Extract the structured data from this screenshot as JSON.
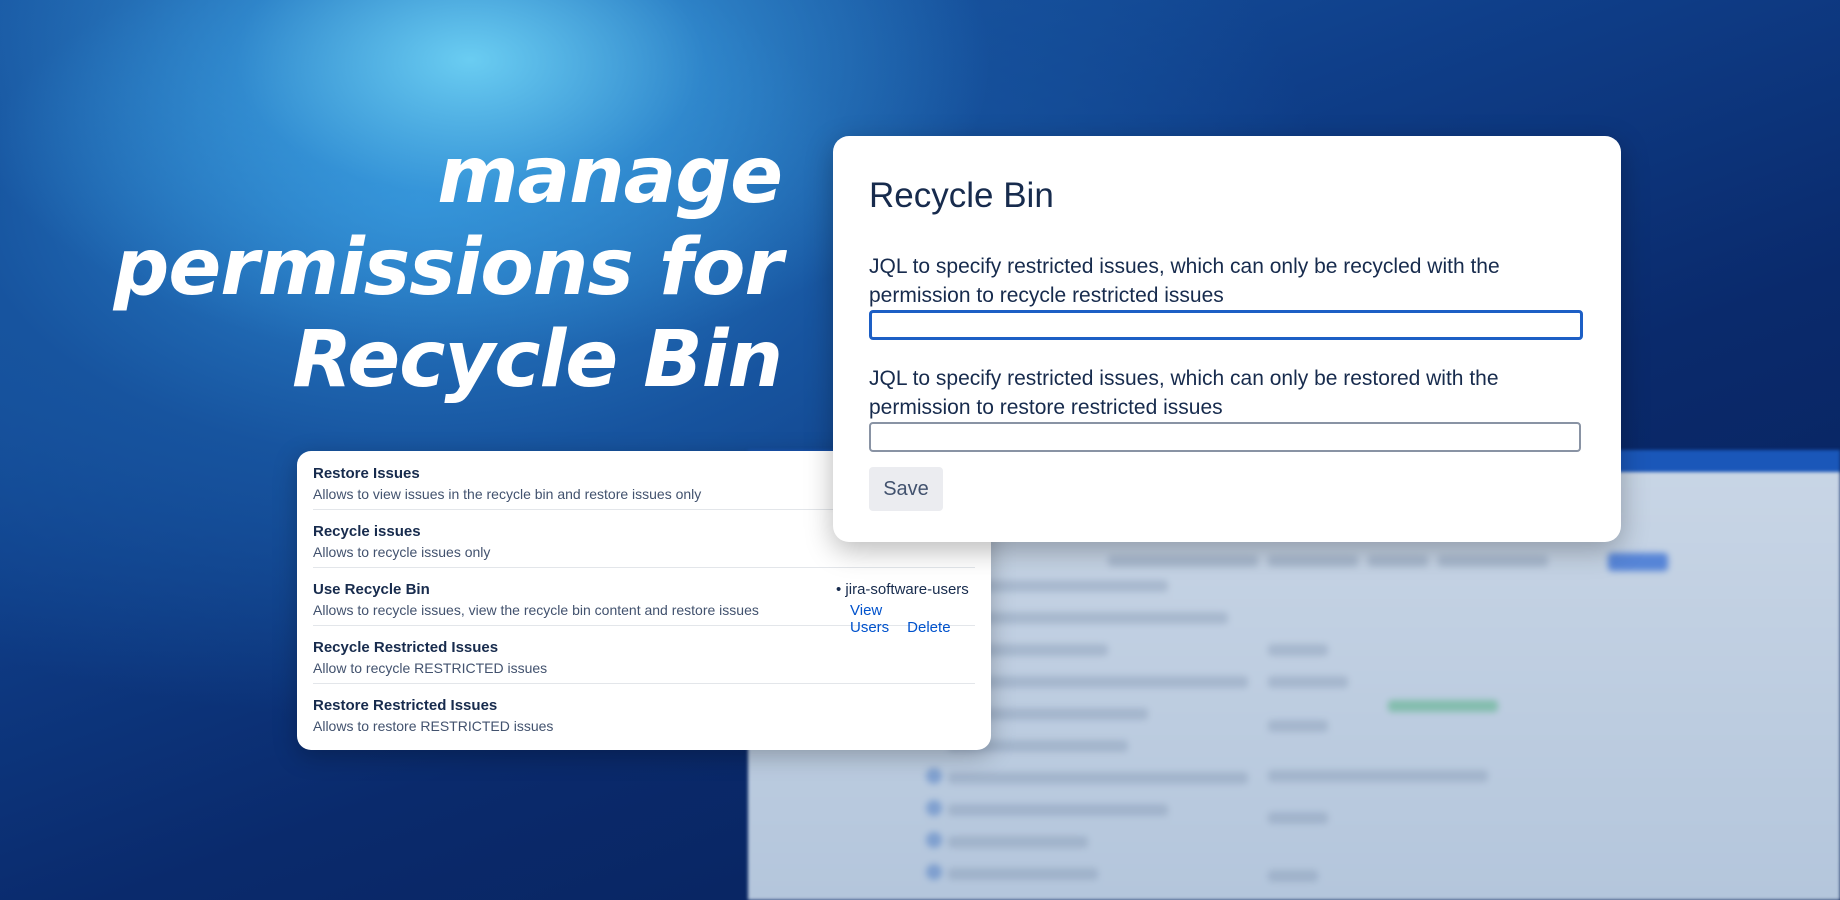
{
  "headline": {
    "line1": "manage",
    "line2": "permissions for",
    "line3": "Recycle Bin"
  },
  "permissions": [
    {
      "title": "Restore Issues",
      "description": "Allows to view issues in the recycle bin and restore issues only"
    },
    {
      "title": "Recycle issues",
      "description": "Allows to recycle issues only"
    },
    {
      "title": "Use Recycle Bin",
      "description": "Allows to recycle issues, view the recycle bin content and restore issues",
      "group": "jira-software-users",
      "view_users_label": "View Users",
      "delete_label": "Delete"
    },
    {
      "title": "Recycle Restricted Issues",
      "description": "Allow to recycle RESTRICTED issues"
    },
    {
      "title": "Restore Restricted Issues",
      "description": "Allows to restore RESTRICTED issues"
    }
  ],
  "recycle_bin": {
    "title": "Recycle Bin",
    "recycle_jql_label": "JQL to specify restricted issues, which can only be recycled with the permission to recycle restricted issues",
    "recycle_jql_value": "",
    "restore_jql_label": "JQL to specify restricted issues, which can only be restored with the permission to restore restricted issues",
    "restore_jql_value": "",
    "save_label": "Save"
  },
  "colors": {
    "accent": "#0052cc",
    "focus_border": "#1d5fc5",
    "text_primary": "#172b4d",
    "text_secondary": "#42526e"
  }
}
